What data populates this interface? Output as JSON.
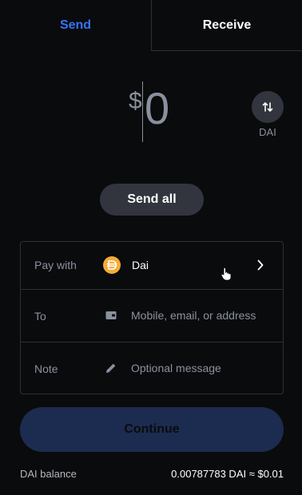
{
  "tabs": {
    "send_label": "Send",
    "receive_label": "Receive",
    "active": "Send"
  },
  "amount": {
    "currency_symbol": "$",
    "value": "0"
  },
  "swap": {
    "label": "DAI",
    "icon": "swap-arrows-icon"
  },
  "send_all_label": "Send all",
  "form": {
    "pay_with": {
      "label": "Pay with",
      "value": "Dai",
      "icon": "dai-coin-icon"
    },
    "to": {
      "label": "To",
      "placeholder": "Mobile, email, or address",
      "icon": "wallet-icon"
    },
    "note": {
      "label": "Note",
      "placeholder": "Optional message",
      "icon": "pencil-icon"
    }
  },
  "continue_label": "Continue",
  "balance": {
    "label": "DAI balance",
    "value": "0.00787783 DAI ≈ $0.01"
  },
  "colors": {
    "background": "#0a0b0d",
    "accent": "#3773f5",
    "muted": "#8a919e",
    "border": "#2f3034",
    "button": "#32353d",
    "continue_disabled": "#1c2c50",
    "dai": "#f5ac37"
  }
}
